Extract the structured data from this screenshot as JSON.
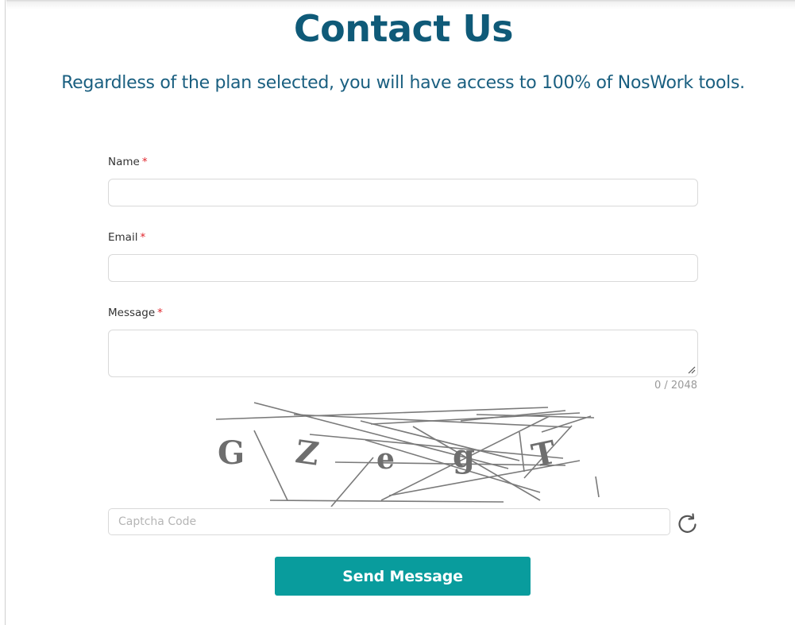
{
  "page": {
    "title": "Contact Us",
    "subtitle": "Regardless of the plan selected, you will have access to 100% of NosWork tools."
  },
  "form": {
    "name_label": "Name",
    "email_label": "Email",
    "message_label": "Message",
    "required_mark": "*",
    "name_value": "",
    "email_value": "",
    "message_value": "",
    "message_counter": "0 / 2048",
    "captcha_placeholder": "Captcha Code",
    "captcha_text": [
      "G",
      "Z",
      "e",
      "g",
      "T"
    ],
    "submit_label": "Send Message"
  },
  "icons": {
    "refresh": "refresh-icon",
    "resize": "resize-grip-icon"
  },
  "colors": {
    "heading": "#0f5a78",
    "subtitle": "#1a5f80",
    "required": "#e0242b",
    "button": "#099c9d",
    "button_text": "#ffffff",
    "captcha_glyphs": "#6e6e6e"
  }
}
